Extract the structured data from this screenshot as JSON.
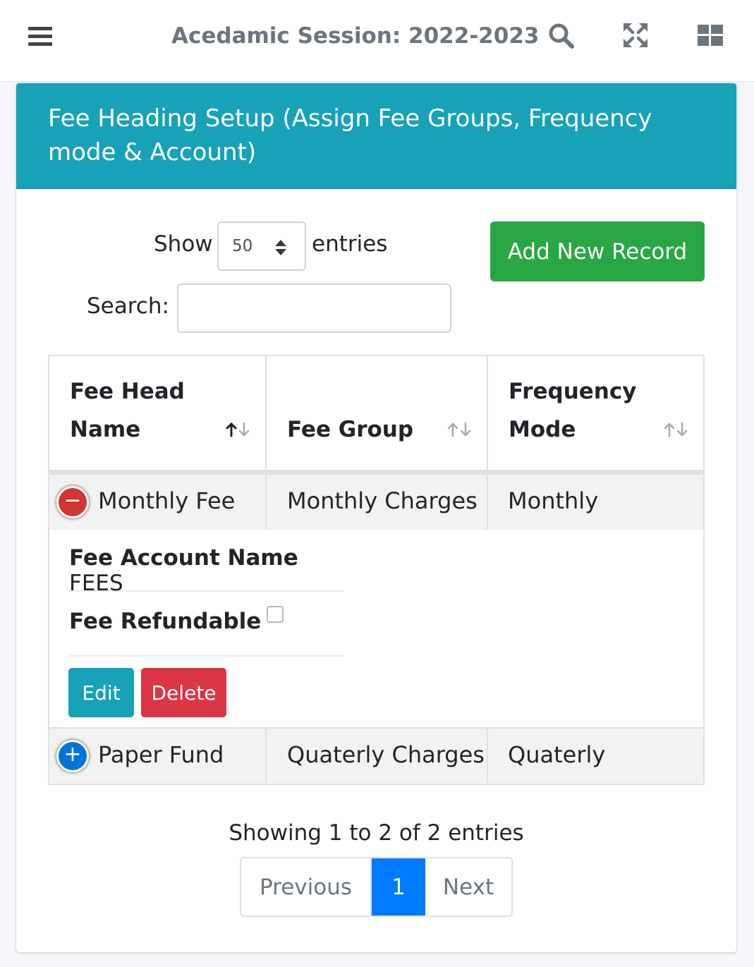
{
  "topbar": {
    "session_title": "Acedamic Session: 2022-2023",
    "icons": [
      "menu-icon",
      "search-icon",
      "fullscreen-icon",
      "grid-icon"
    ]
  },
  "card": {
    "title": "Fee Heading Setup (Assign Fee Groups, Frequency mode & Account)",
    "header_color": "#17a2b8"
  },
  "controls": {
    "show_label": "Show",
    "entries_value": "50",
    "entries_label": "entries",
    "search_label": "Search:",
    "search_value": "",
    "add_button": "Add New Record",
    "add_button_color": "#28a745"
  },
  "table": {
    "columns": [
      {
        "label": "Fee Head Name",
        "sort": "ascending"
      },
      {
        "label": "Fee Group",
        "sort": "none"
      },
      {
        "label": "Frequency Mode",
        "sort": "none"
      }
    ],
    "rows": [
      {
        "fee_head": "Monthly Fee",
        "fee_group": "Monthly Charges",
        "frequency": "Monthly",
        "expanded": true,
        "toggle": "minus-icon",
        "toggle_color": "#d33333"
      },
      {
        "fee_head": "Paper Fund",
        "fee_group": "Quaterly Charges",
        "frequency": "Quaterly",
        "expanded": false,
        "toggle": "plus-icon",
        "toggle_color": "#0275d8"
      }
    ],
    "child": {
      "account_label": "Fee Account Name",
      "account_value": "FEES",
      "refundable_label": "Fee Refundable",
      "refundable_checked": false,
      "edit_button": "Edit",
      "delete_button": "Delete"
    }
  },
  "footer": {
    "info": "Showing 1 to 2 of 2 entries",
    "previous": "Previous",
    "page": "1",
    "next": "Next"
  }
}
